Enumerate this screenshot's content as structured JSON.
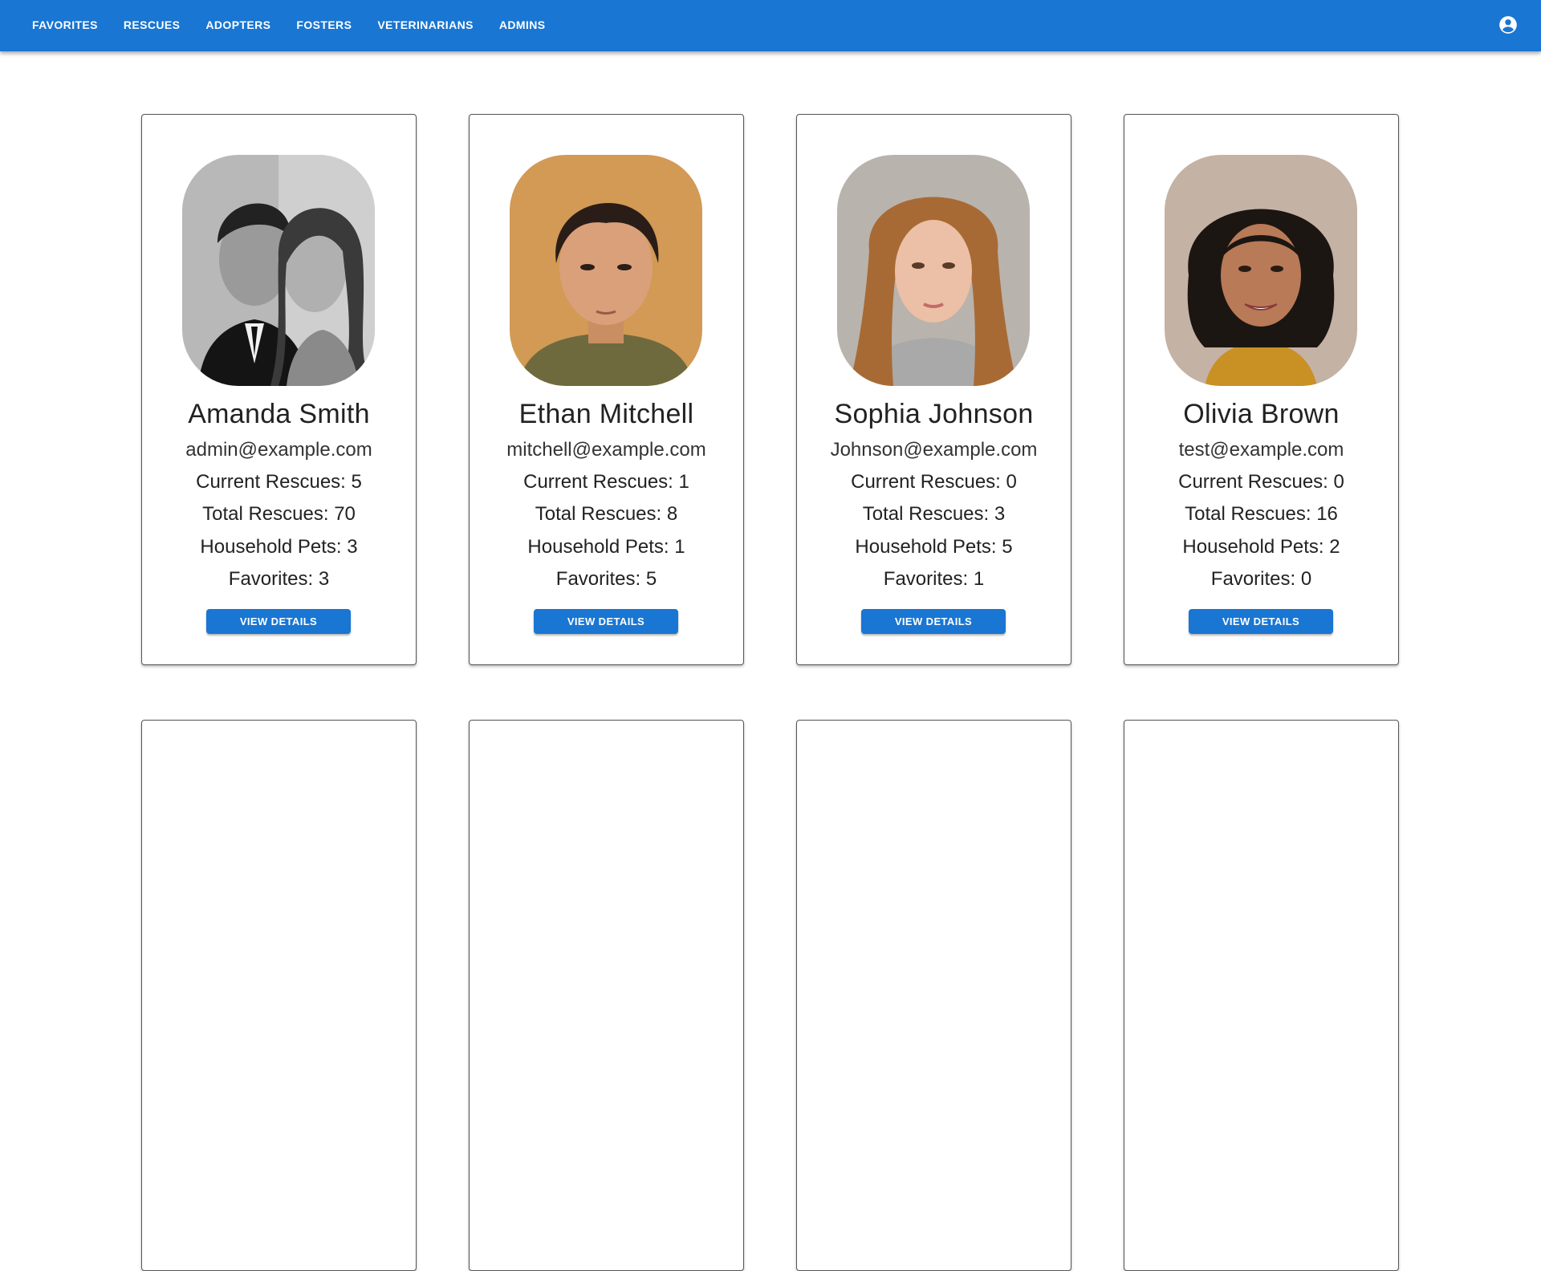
{
  "nav": {
    "items": [
      "FAVORITES",
      "RESCUES",
      "ADOPTERS",
      "FOSTERS",
      "VETERINARIANS",
      "ADMINS"
    ],
    "account_icon": "account-circle-icon"
  },
  "colors": {
    "appbar": "#1976d2",
    "button": "#1976d2",
    "card_border": "#555555"
  },
  "stat_labels": {
    "current": "Current Rescues:",
    "total": "Total Rescues:",
    "pets": "Household Pets:",
    "favorites": "Favorites:"
  },
  "button_label": "VIEW DETAILS",
  "users": [
    {
      "name": "Amanda Smith",
      "email": "admin@example.com",
      "current_rescues": "5",
      "total_rescues": "70",
      "household_pets": "3",
      "favorites": "3"
    },
    {
      "name": "Ethan Mitchell",
      "email": "mitchell@example.com",
      "current_rescues": "1",
      "total_rescues": "8",
      "household_pets": "1",
      "favorites": "5"
    },
    {
      "name": "Sophia Johnson",
      "email": "Johnson@example.com",
      "current_rescues": "0",
      "total_rescues": "3",
      "household_pets": "5",
      "favorites": "1"
    },
    {
      "name": "Olivia Brown",
      "email": "test@example.com",
      "current_rescues": "0",
      "total_rescues": "16",
      "household_pets": "2",
      "favorites": "0"
    }
  ]
}
